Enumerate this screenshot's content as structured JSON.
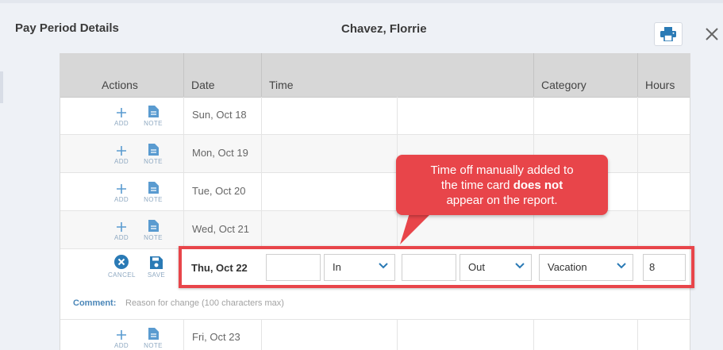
{
  "modal": {
    "title": "Pay Period Details",
    "employee_name": "Chavez, Florrie",
    "print_icon": "printer-icon",
    "close_icon": "close-icon"
  },
  "table": {
    "headers": {
      "actions": "Actions",
      "date": "Date",
      "time": "Time",
      "category": "Category",
      "hours": "Hours"
    },
    "action_labels": {
      "add": "ADD",
      "note": "NOTE",
      "cancel": "CANCEL",
      "save": "SAVE"
    },
    "rows": [
      {
        "date": "Sun, Oct 18"
      },
      {
        "date": "Mon, Oct 19"
      },
      {
        "date": "Tue, Oct 20"
      },
      {
        "date": "Wed, Oct 21"
      },
      {
        "date": "Fri, Oct 23"
      }
    ],
    "edit_row": {
      "date": "Thu, Oct 22",
      "in_time": "",
      "in_label": "In",
      "out_time": "",
      "out_label": "Out",
      "category": "Vacation",
      "hours": "8"
    },
    "comment": {
      "label": "Comment:",
      "placeholder": "Reason for change (100 characters max)"
    }
  },
  "annotation": {
    "line1": "Time off manually added to",
    "line2_pre": "the time card ",
    "line2_bold": "does not",
    "line3": "appear on the report.",
    "color": "#e8454a"
  },
  "colors": {
    "accent": "#2a7ab5",
    "icon_blue": "#5a9bd0",
    "header_bg": "#d7d7d7"
  }
}
